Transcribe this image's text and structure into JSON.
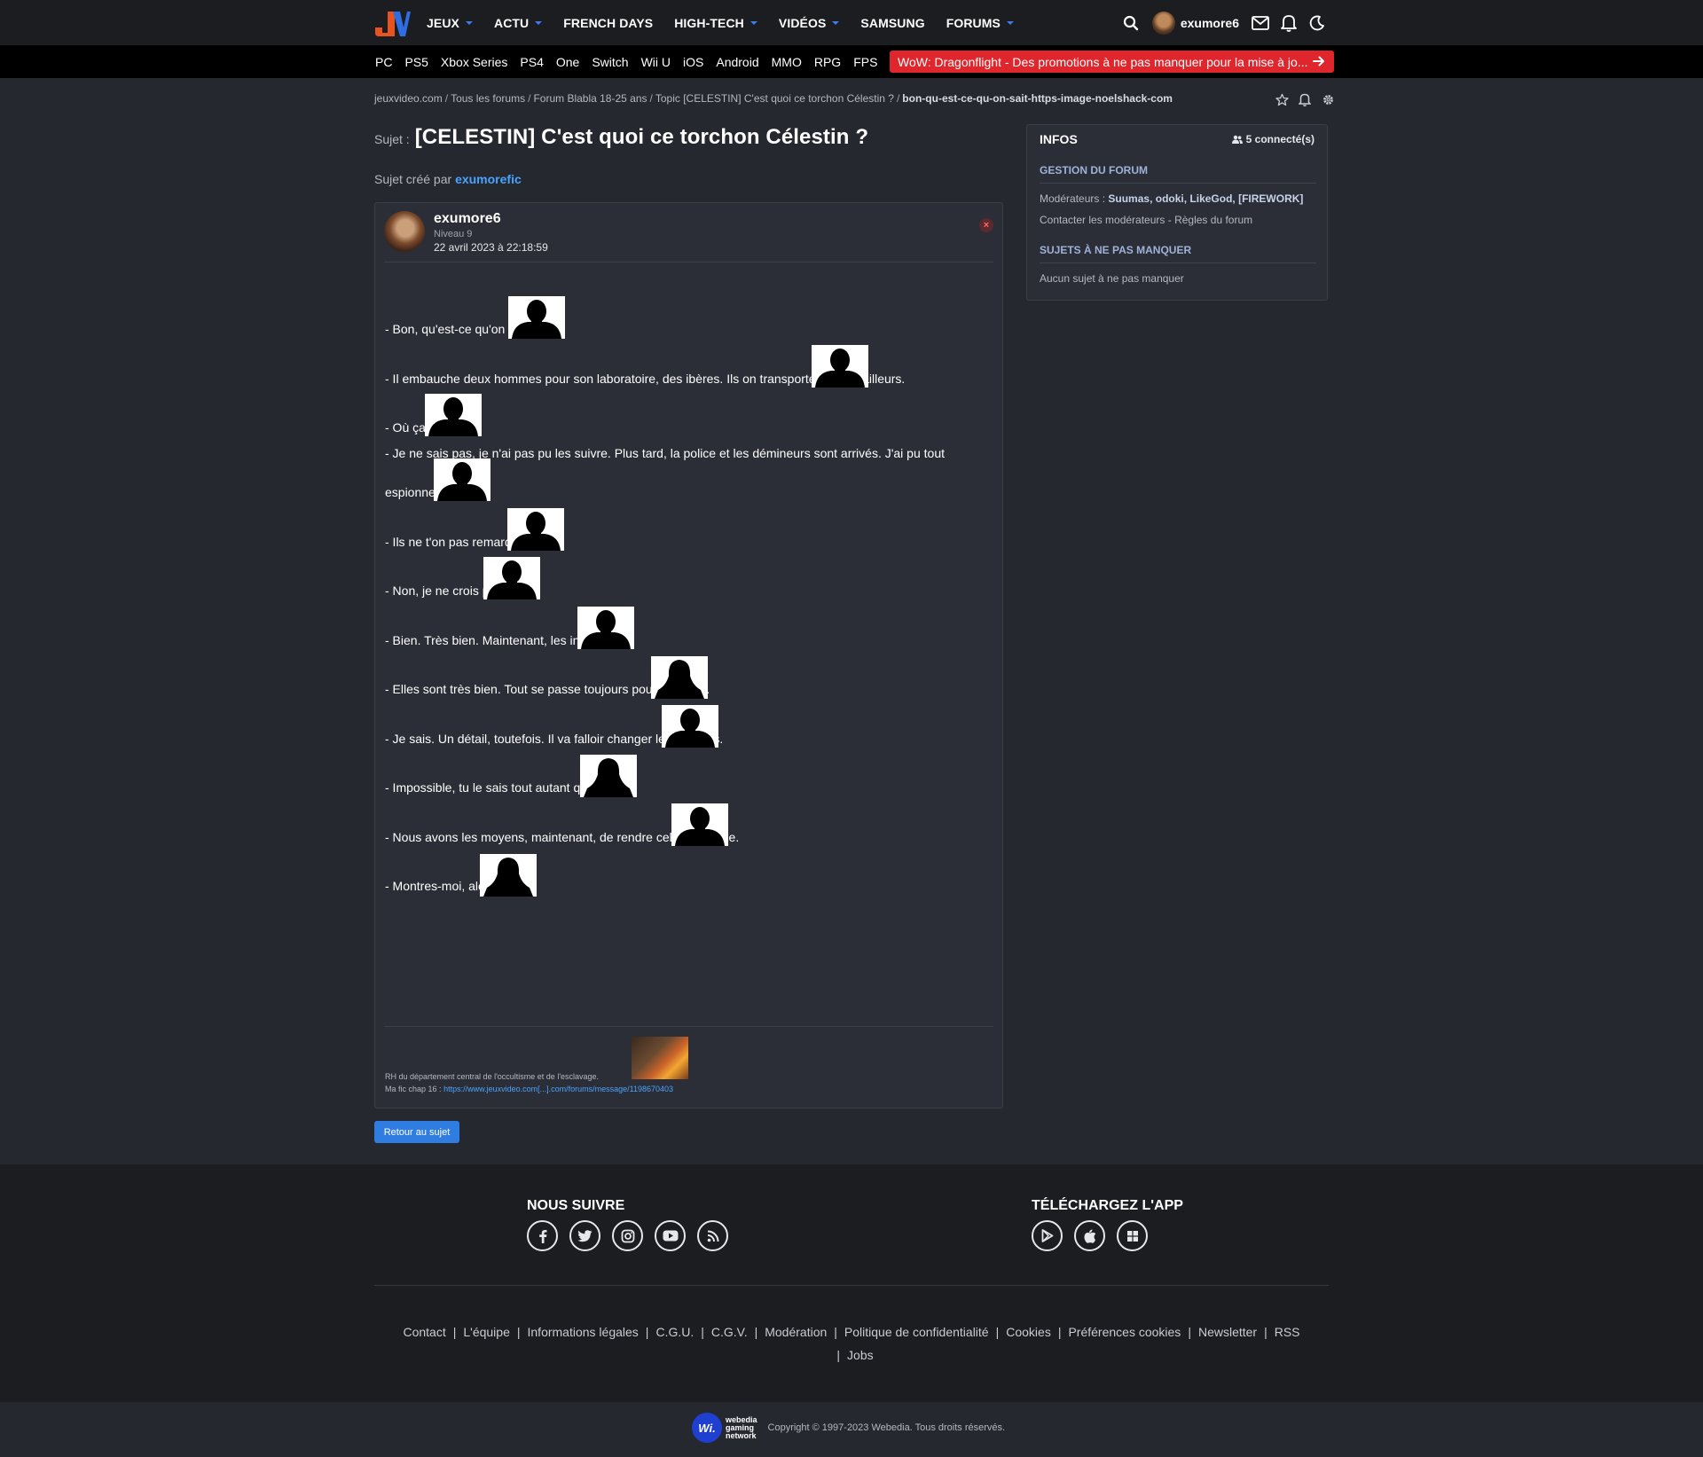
{
  "nav": {
    "items": [
      {
        "label": "JEUX",
        "caret": true
      },
      {
        "label": "ACTU",
        "caret": true
      },
      {
        "label": "FRENCH DAYS",
        "caret": false
      },
      {
        "label": "HIGH-TECH",
        "caret": true
      },
      {
        "label": "VIDÉOS",
        "caret": true
      },
      {
        "label": "SAMSUNG",
        "caret": false
      },
      {
        "label": "FORUMS",
        "caret": true
      }
    ],
    "username": "exumore6"
  },
  "platforms": [
    "PC",
    "PS5",
    "Xbox Series",
    "PS4",
    "One",
    "Switch",
    "Wii U",
    "iOS",
    "Android",
    "MMO",
    "RPG",
    "FPS"
  ],
  "promo": "WoW: Dragonflight - Des promotions à ne pas manquer pour la mise à jo...",
  "breadcrumb": {
    "items": [
      "jeuxvideo.com",
      "Tous les forums",
      "Forum Blabla 18-25 ans",
      "Topic [CELESTIN] C'est quoi ce torchon Célestin ?"
    ],
    "current": "bon-qu-est-ce-qu-on-sait-https-image-noelshack-com",
    "sep": "/"
  },
  "topic": {
    "label": "Sujet :",
    "title": "[CELESTIN] C'est quoi ce torchon Célestin ?",
    "created_by_label": "Sujet créé par",
    "created_by": "exumorefic"
  },
  "post": {
    "author": "exumore6",
    "level": "Niveau 9",
    "date": "22 avril 2023 à 22:18:59",
    "close": "×",
    "lines": [
      "- Bon, qu'est-ce qu'on sait ?",
      "- Il embauche deux hommes pour son laboratoire, des ibères. Ils on transporté l'enfant ailleurs.",
      "- Où ça ?",
      "- Je ne sais pas, je n'ai pas pu les suivre. Plus tard, la police et les démineurs sont arrivés. J'ai pu tout",
      "espionner.",
      "- Ils ne t'on pas remarqué ?",
      "- Non, je ne crois pas.",
      "- Bien. Très bien. Maintenant, les interview.",
      "- Elles sont très bien. Tout se passe toujours pour le mieux.",
      "- Je sais. Un détail, toutefois. Il va falloir changer les horaires.",
      "- Impossible, tu le sais tout autant que moi.",
      "- Nous avons les moyens, maintenant, de rendre cela réalisable.",
      "- Montres-moi, alors."
    ],
    "signature": {
      "line1": "RH du département central de l'occultisme et de l'esclavage.",
      "line2_prefix": "Ma fic chap 16 :",
      "link": "https://www.jeuxvideo.com[...].com/forums/message/1198670403"
    }
  },
  "return_button": "Retour au sujet",
  "sidebar": {
    "title": "INFOS",
    "connected": "5 connecté(s)",
    "section1": "GESTION DU FORUM",
    "moderators_label": "Modérateurs :",
    "moderators": "Suumas, odoki, LikeGod, [FIREWORK]",
    "contact": "Contacter les modérateurs",
    "dash": " - ",
    "rules": "Règles du forum",
    "section2": "SUJETS À NE PAS MANQUER",
    "none": "Aucun sujet à ne pas manquer"
  },
  "footer": {
    "follow": "NOUS SUIVRE",
    "app": "TÉLÉCHARGEZ L'APP",
    "links_row1": [
      "Contact",
      "L'équipe",
      "Informations légales",
      "C.G.U.",
      "C.G.V.",
      "Modération",
      "Politique de confidentialité",
      "Cookies",
      "Préférences cookies",
      "Newsletter",
      "RSS"
    ],
    "links_row2": [
      "Jobs"
    ],
    "link_sep": "|",
    "wgn_logo": "Wi.",
    "wgn_lines": [
      "webedia",
      "gaming",
      "network"
    ],
    "copyright": "Copyright © 1997-2023 Webedia. Tous droits réservés."
  },
  "icons": {
    "social": [
      "facebook-icon",
      "twitter-icon",
      "instagram-icon",
      "youtube-icon",
      "rss-icon"
    ],
    "app": [
      "google-play-icon",
      "apple-icon",
      "windows-icon"
    ]
  },
  "colors": {
    "accent": "#3f7cf0",
    "link": "#4aa3ff",
    "promo": "#e0262d",
    "background": "#25282f",
    "header": "#1b1d21"
  }
}
